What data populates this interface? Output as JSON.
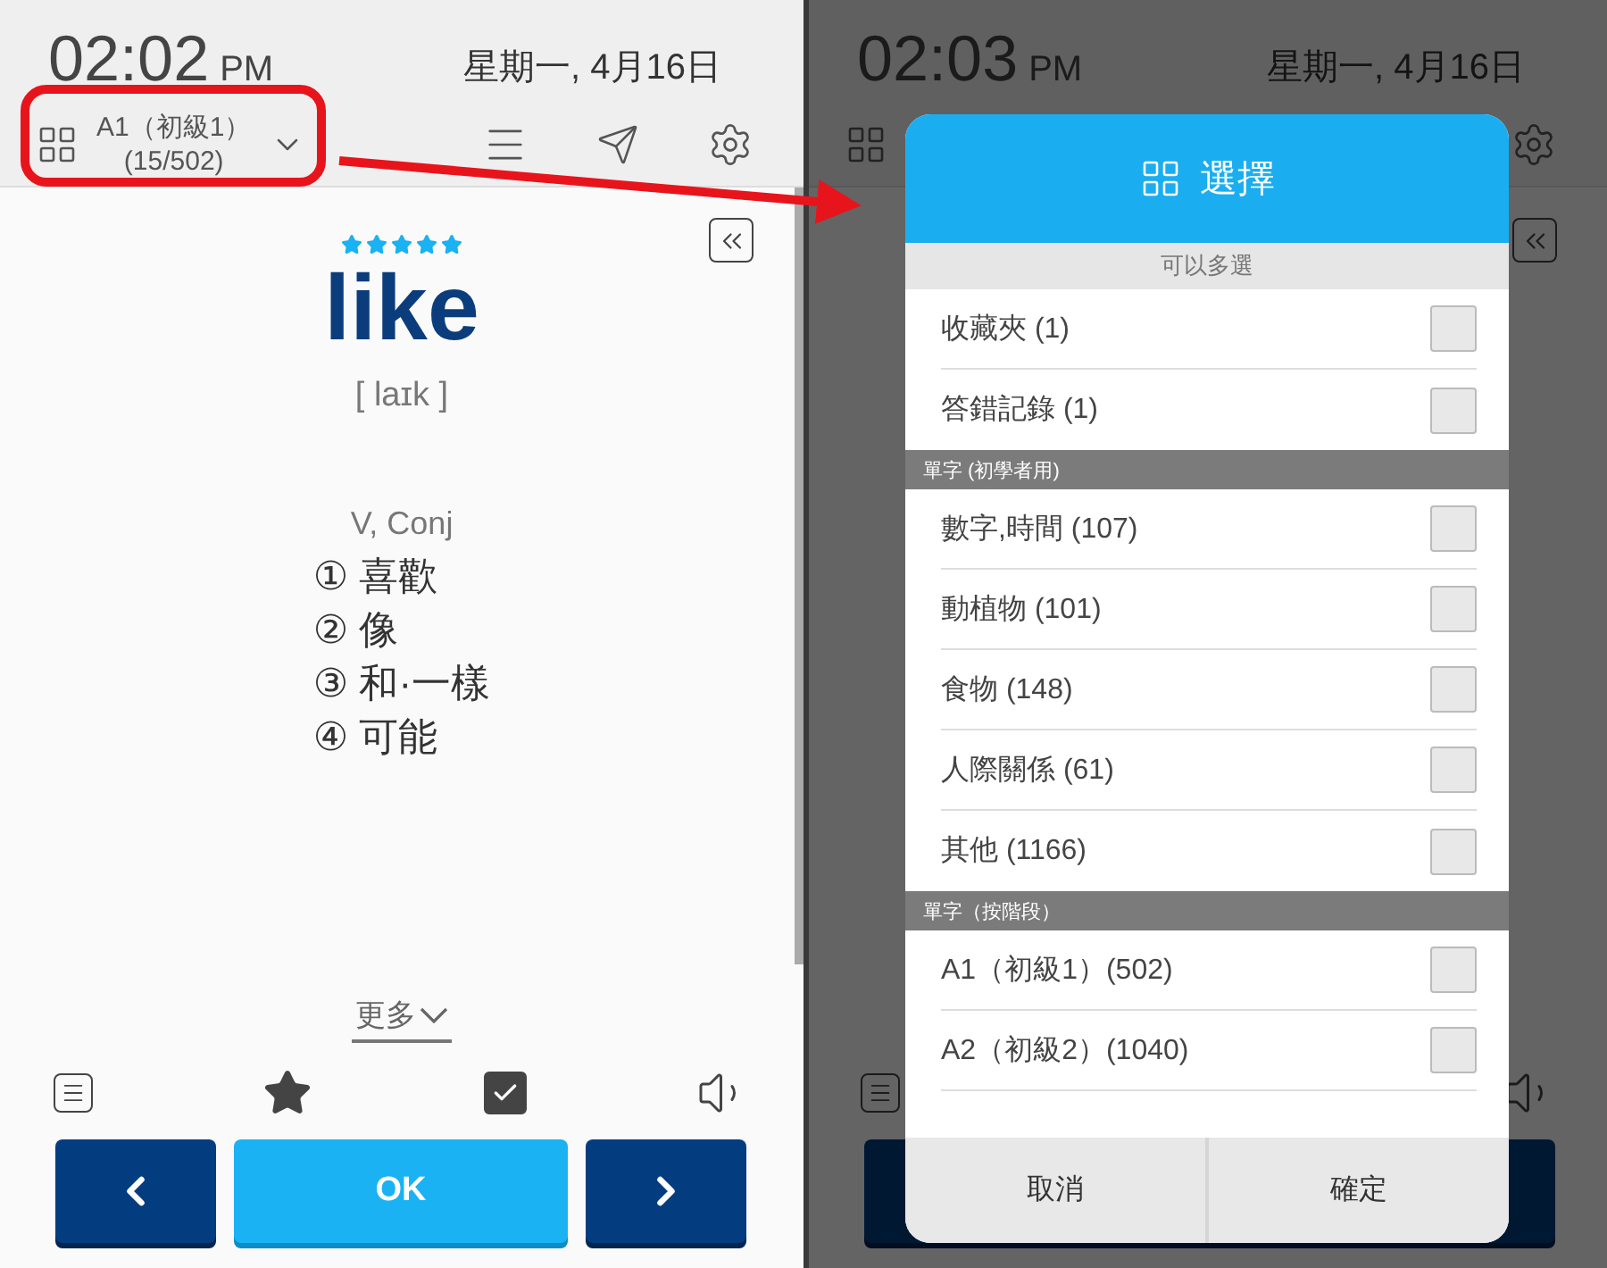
{
  "left_screen": {
    "time": "02:02",
    "meridiem": "PM",
    "date": "星期一, 4月16日",
    "selector": {
      "title": "A1（初級1）",
      "progress": "(15/502)"
    },
    "card": {
      "stars": 5,
      "word": "like",
      "phonetic": "[ laɪk ]",
      "part_of_speech": "V, Conj",
      "meanings": [
        "① 喜歡",
        "② 像",
        "③ 和·一樣",
        "④ 可能"
      ],
      "more": "更多"
    },
    "actions": {
      "favorite": true,
      "learned": true
    },
    "ok_button": "OK"
  },
  "right_screen": {
    "time": "02:03",
    "meridiem": "PM",
    "date": "星期一, 4月16日",
    "dialog": {
      "title": "選擇",
      "groups": [
        {
          "kind": "hint",
          "header": "可以多選",
          "items": [
            {
              "label": "收藏夾 (1)",
              "checked": false
            },
            {
              "label": "答錯記錄 (1)",
              "checked": false
            }
          ]
        },
        {
          "kind": "section",
          "header": "單字 (初學者用)",
          "items": [
            {
              "label": "數字,時間 (107)",
              "checked": false
            },
            {
              "label": "動植物 (101)",
              "checked": false
            },
            {
              "label": "食物 (148)",
              "checked": false
            },
            {
              "label": "人際關係 (61)",
              "checked": false
            },
            {
              "label": "其他 (1166)",
              "checked": false
            }
          ]
        },
        {
          "kind": "section",
          "header": "單字（按階段）",
          "items": [
            {
              "label": "A1（初級1）(502)",
              "checked": false
            },
            {
              "label": "A2（初級2）(1040)",
              "checked": false
            }
          ]
        }
      ],
      "buttons": [
        "取消",
        "確定"
      ]
    }
  }
}
